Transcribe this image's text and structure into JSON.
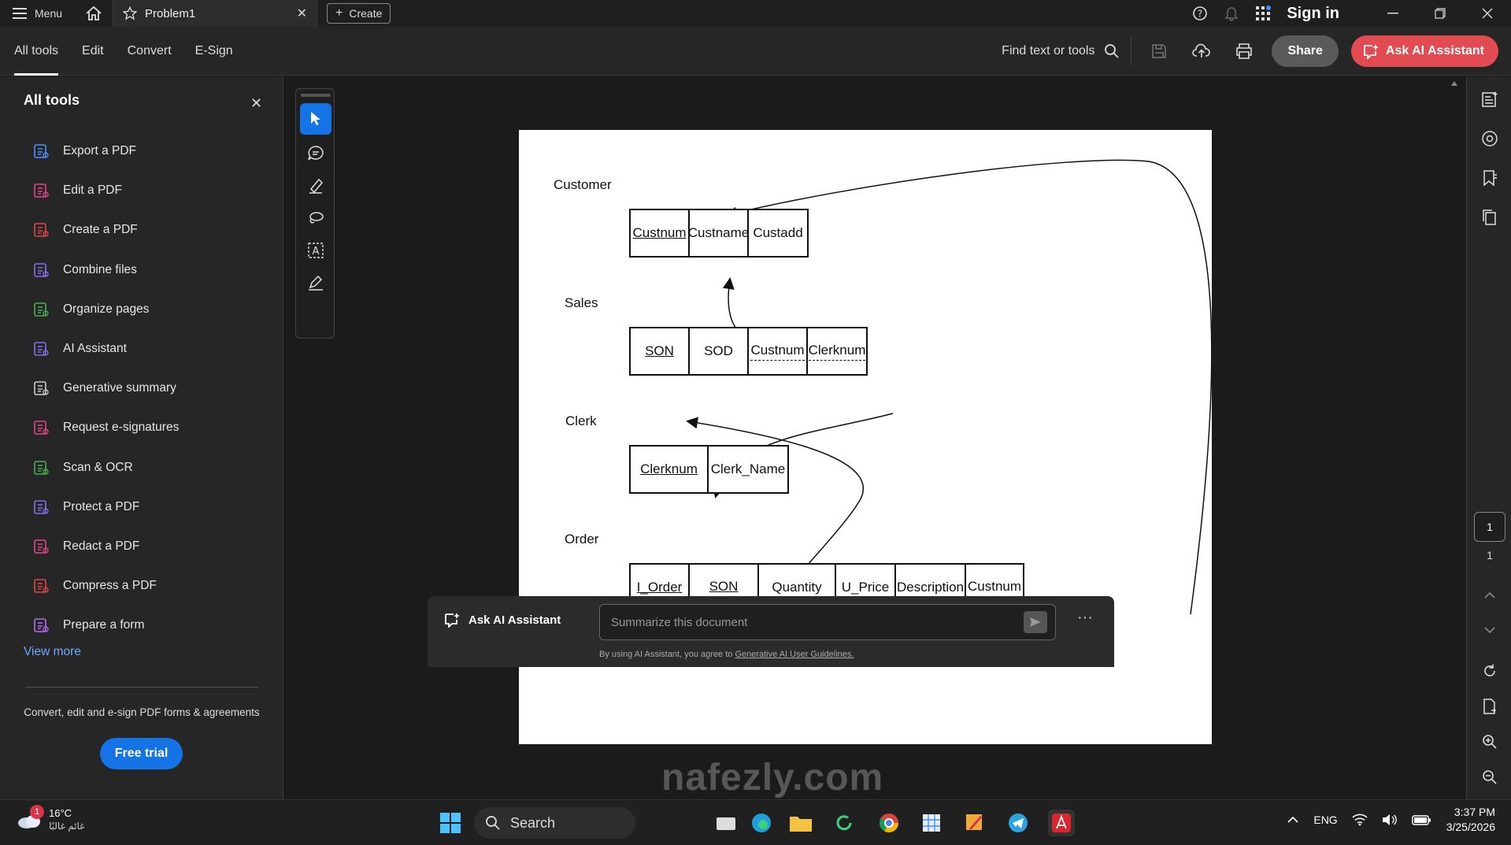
{
  "titlebar": {
    "menu_label": "Menu",
    "tab_title": "Problem1",
    "create_label": "Create",
    "sign_in": "Sign in"
  },
  "toolbar": {
    "nav": [
      "All tools",
      "Edit",
      "Convert",
      "E-Sign"
    ],
    "find_label": "Find text or tools",
    "share_label": "Share",
    "ai_label": "Ask AI Assistant"
  },
  "left_panel": {
    "title": "All tools",
    "tools": [
      {
        "label": "Export a PDF",
        "icon": "export-pdf-icon",
        "color": "#4c8dff"
      },
      {
        "label": "Edit a PDF",
        "icon": "edit-pdf-icon",
        "color": "#e0458e"
      },
      {
        "label": "Create a PDF",
        "icon": "create-pdf-icon",
        "color": "#e0454a"
      },
      {
        "label": "Combine files",
        "icon": "combine-files-icon",
        "color": "#8a6cf0"
      },
      {
        "label": "Organize pages",
        "icon": "organize-pages-icon",
        "color": "#4caf50"
      },
      {
        "label": "AI Assistant",
        "icon": "ai-assistant-icon",
        "color": "#8a6cf0"
      },
      {
        "label": "Generative summary",
        "icon": "generative-summary-icon",
        "color": "#cccccc"
      },
      {
        "label": "Request e-signatures",
        "icon": "request-esignatures-icon",
        "color": "#e0458e"
      },
      {
        "label": "Scan & OCR",
        "icon": "scan-ocr-icon",
        "color": "#4caf50"
      },
      {
        "label": "Protect a PDF",
        "icon": "protect-pdf-icon",
        "color": "#8a6cf0"
      },
      {
        "label": "Redact a PDF",
        "icon": "redact-pdf-icon",
        "color": "#e0458e"
      },
      {
        "label": "Compress a PDF",
        "icon": "compress-pdf-icon",
        "color": "#e0454a"
      },
      {
        "label": "Prepare a form",
        "icon": "prepare-form-icon",
        "color": "#b06cf0"
      }
    ],
    "view_more": "View more",
    "promo": "Convert, edit and e-sign PDF forms & agreements",
    "trial_label": "Free trial"
  },
  "document": {
    "relations": [
      {
        "name": "Customer",
        "columns": [
          {
            "text": "Custnum",
            "key": "pk"
          },
          {
            "text": "Custname",
            "key": ""
          },
          {
            "text": "Custadd",
            "key": ""
          }
        ]
      },
      {
        "name": "Sales",
        "columns": [
          {
            "text": "SON",
            "key": "pk"
          },
          {
            "text": "SOD",
            "key": ""
          },
          {
            "text": "Custnum",
            "key": "fk"
          },
          {
            "text": "Clerknum",
            "key": "fk"
          }
        ]
      },
      {
        "name": "Clerk",
        "columns": [
          {
            "text": "Clerknum",
            "key": "pk"
          },
          {
            "text": "Clerk_Name",
            "key": ""
          }
        ]
      },
      {
        "name": "Order",
        "columns": [
          {
            "text": "I_Order",
            "key": "pk"
          },
          {
            "text": "SON",
            "key": "pk-fk"
          },
          {
            "text": "Quantity",
            "key": ""
          },
          {
            "text": "U_Price",
            "key": ""
          },
          {
            "text": "Description",
            "key": ""
          },
          {
            "text": "Custnum",
            "key": "fk"
          }
        ]
      }
    ]
  },
  "ai_bar": {
    "label": "Ask AI Assistant",
    "placeholder": "Summarize this document",
    "footnote_prefix": "By using AI Assistant, you agree to ",
    "footnote_link": "Generative AI User Guidelines."
  },
  "page_nav": {
    "current": "1",
    "total": "1"
  },
  "taskbar": {
    "weather_temp": "16°C",
    "weather_desc": "غائم غالبًا",
    "notif_count": "1",
    "search_label": "Search",
    "lang": "ENG",
    "time": "3:37 PM",
    "date": "3/25/2026"
  },
  "watermark": "nafezly.com"
}
